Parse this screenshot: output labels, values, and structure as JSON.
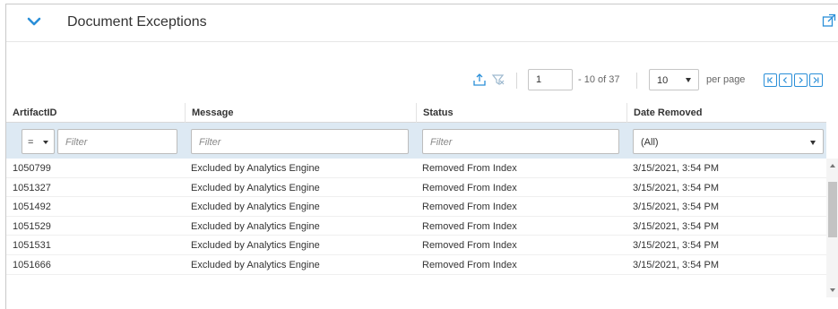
{
  "panel": {
    "title": "Document Exceptions"
  },
  "toolbar": {
    "page_value": "1",
    "page_total": "- 10 of 37",
    "per_page_value": "10",
    "per_page_label": "per page"
  },
  "columns": [
    "ArtifactID",
    "Message",
    "Status",
    "Date Removed"
  ],
  "filters": {
    "operator": "=",
    "artifact_placeholder": "Filter",
    "message_placeholder": "Filter",
    "status_placeholder": "Filter",
    "date_value": "(All)"
  },
  "rows": [
    [
      "1050799",
      "Excluded by Analytics Engine",
      "Removed From Index",
      "3/15/2021, 3:54 PM"
    ],
    [
      "1051327",
      "Excluded by Analytics Engine",
      "Removed From Index",
      "3/15/2021, 3:54 PM"
    ],
    [
      "1051492",
      "Excluded by Analytics Engine",
      "Removed From Index",
      "3/15/2021, 3:54 PM"
    ],
    [
      "1051529",
      "Excluded by Analytics Engine",
      "Removed From Index",
      "3/15/2021, 3:54 PM"
    ],
    [
      "1051531",
      "Excluded by Analytics Engine",
      "Removed From Index",
      "3/15/2021, 3:54 PM"
    ],
    [
      "1051666",
      "Excluded by Analytics Engine",
      "Removed From Index",
      "3/15/2021, 3:54 PM"
    ]
  ],
  "icons": {
    "collapse": "chevron-down-icon",
    "popout": "popout-icon",
    "export": "export-icon",
    "clear_filters": "clear-filters-icon",
    "first_page": "first-page-icon",
    "prev_page": "prev-page-icon",
    "next_page": "next-page-icon",
    "last_page": "last-page-icon"
  },
  "colors": {
    "accent": "#2a8fd8",
    "filter_row_bg": "#dde9f3"
  }
}
